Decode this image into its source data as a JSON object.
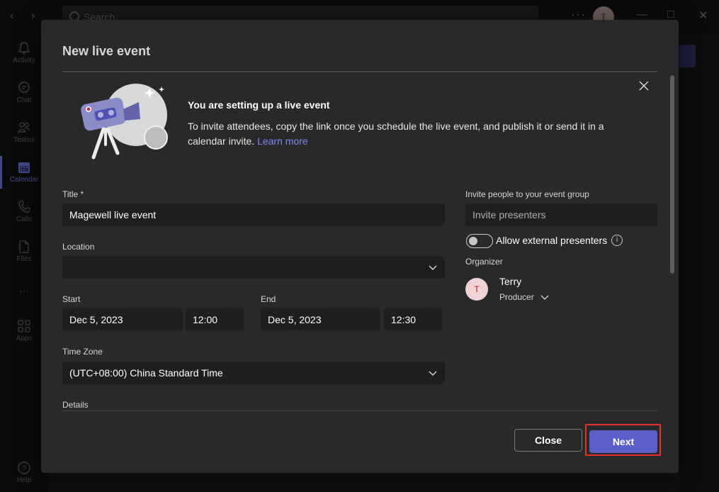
{
  "titlebar": {
    "back_icon": "chevron-left-icon",
    "forward_icon": "chevron-right-icon",
    "search_placeholder": "Search",
    "more_label": "···",
    "avatar_initial": "T"
  },
  "rail": {
    "items": [
      {
        "label": "Activity",
        "icon": "bell-icon"
      },
      {
        "label": "Chat",
        "icon": "chat-icon"
      },
      {
        "label": "Teams",
        "icon": "teams-icon"
      },
      {
        "label": "Calendar",
        "icon": "calendar-icon",
        "active": true
      },
      {
        "label": "Calls",
        "icon": "phone-icon"
      },
      {
        "label": "Files",
        "icon": "file-icon"
      },
      {
        "label": "···",
        "icon": "more-icon"
      },
      {
        "label": "Apps",
        "icon": "apps-icon"
      }
    ],
    "help_label": "Help"
  },
  "dialog": {
    "title": "New live event",
    "info": {
      "title": "You are setting up a live event",
      "body": "To invite attendees, copy the link once you schedule the live event, and publish it or send it in a calendar invite.",
      "link": "Learn more"
    },
    "form": {
      "title_label": "Title *",
      "title_value": "Magewell live event",
      "location_label": "Location",
      "location_value": "",
      "start_label": "Start",
      "start_date": "Dec 5, 2023",
      "start_time": "12:00",
      "end_label": "End",
      "end_date": "Dec 5, 2023",
      "end_time": "12:30",
      "timezone_label": "Time Zone",
      "timezone_value": "(UTC+08:00) China Standard Time",
      "details_label": "Details"
    },
    "invite": {
      "label": "Invite people to your event group",
      "placeholder": "Invite presenters",
      "toggle_label": "Allow external presenters",
      "toggle_on": false
    },
    "organizer": {
      "label": "Organizer",
      "initial": "T",
      "name": "Terry",
      "role": "Producer"
    },
    "buttons": {
      "close": "Close",
      "next": "Next"
    }
  },
  "colors": {
    "accent": "#5b5fc7",
    "link": "#7f85f5",
    "highlight": "#e0312d",
    "dialog_bg": "#292929"
  }
}
